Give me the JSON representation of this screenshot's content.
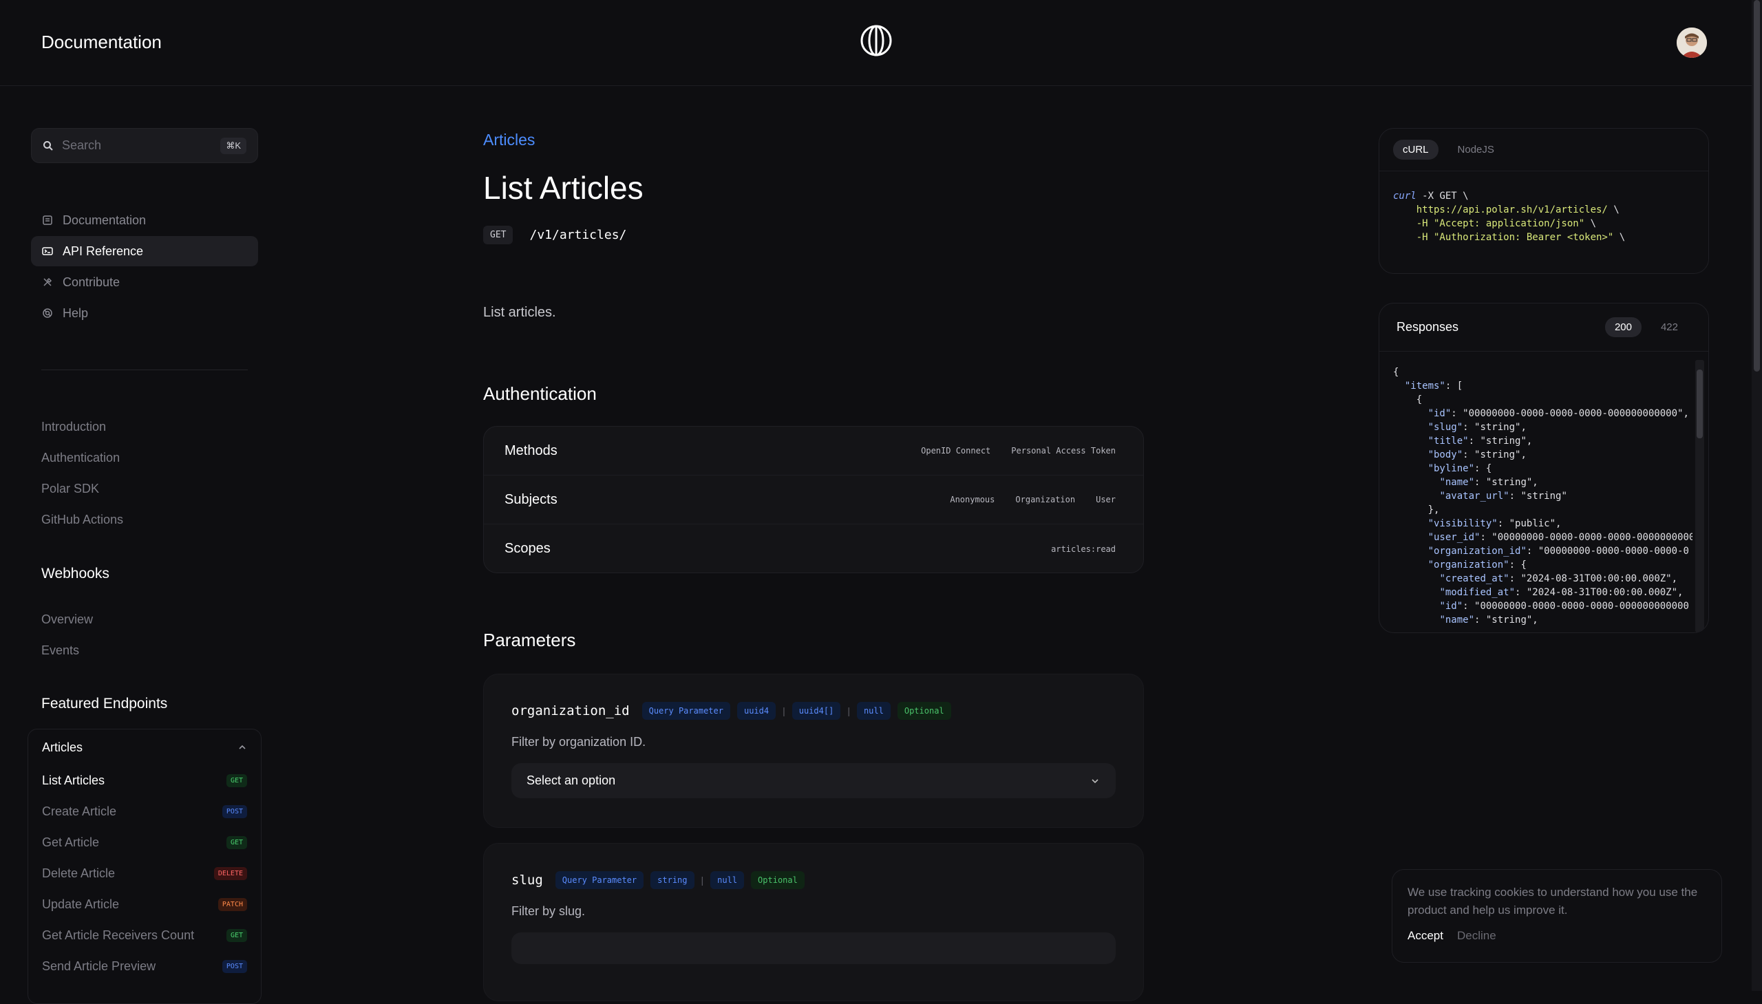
{
  "header": {
    "title": "Documentation"
  },
  "search": {
    "placeholder": "Search",
    "shortcut": "⌘K"
  },
  "sidebar": {
    "main_items": [
      {
        "label": "Documentation",
        "icon": "book-icon"
      },
      {
        "label": "API Reference",
        "icon": "terminal-icon",
        "active": true
      },
      {
        "label": "Contribute",
        "icon": "tools-icon"
      },
      {
        "label": "Help",
        "icon": "lifebuoy-icon"
      }
    ],
    "sub_items": [
      "Introduction",
      "Authentication",
      "Polar SDK",
      "GitHub Actions"
    ],
    "webhooks": {
      "title": "Webhooks",
      "items": [
        "Overview",
        "Events"
      ]
    },
    "featured": {
      "title": "Featured Endpoints",
      "group": "Articles",
      "endpoints": [
        {
          "label": "List Articles",
          "method": "GET",
          "active": true
        },
        {
          "label": "Create Article",
          "method": "POST"
        },
        {
          "label": "Get Article",
          "method": "GET"
        },
        {
          "label": "Delete Article",
          "method": "DELETE"
        },
        {
          "label": "Update Article",
          "method": "PATCH"
        },
        {
          "label": "Get Article Receivers Count",
          "method": "GET"
        },
        {
          "label": "Send Article Preview",
          "method": "POST"
        }
      ]
    }
  },
  "main": {
    "breadcrumb": "Articles",
    "title": "List Articles",
    "method": "GET",
    "endpoint": "/v1/articles/",
    "description": "List articles.",
    "auth": {
      "title": "Authentication",
      "rows": [
        {
          "label": "Methods",
          "values": [
            "OpenID Connect",
            "Personal Access Token"
          ]
        },
        {
          "label": "Subjects",
          "values": [
            "Anonymous",
            "Organization",
            "User"
          ]
        },
        {
          "label": "Scopes",
          "values": [
            "articles:read"
          ]
        }
      ]
    },
    "parameters": {
      "title": "Parameters",
      "items": [
        {
          "name": "organization_id",
          "location": "Query Parameter",
          "types": [
            "uuid4",
            "uuid4[]",
            "null"
          ],
          "optional": "Optional",
          "description": "Filter by organization ID.",
          "select_placeholder": "Select an option"
        },
        {
          "name": "slug",
          "location": "Query Parameter",
          "types": [
            "string",
            "null"
          ],
          "optional": "Optional",
          "description": "Filter by slug."
        }
      ]
    }
  },
  "code_panel": {
    "tabs": [
      "cURL",
      "NodeJS"
    ],
    "active_tab": "cURL",
    "lines": [
      "curl -X GET \\",
      "  https://api.polar.sh/v1/articles/ \\",
      "  -H \"Accept: application/json\" \\",
      "  -H \"Authorization: Bearer <token>\" \\"
    ]
  },
  "responses": {
    "title": "Responses",
    "codes": [
      "200",
      "422"
    ],
    "active_code": "200",
    "json_lines": [
      "{",
      "  \"items\": [",
      "    {",
      "      \"id\": \"00000000-0000-0000-0000-000000000000\",",
      "      \"slug\": \"string\",",
      "      \"title\": \"string\",",
      "      \"body\": \"string\",",
      "      \"byline\": {",
      "        \"name\": \"string\",",
      "        \"avatar_url\": \"string\"",
      "      },",
      "      \"visibility\": \"public\",",
      "      \"user_id\": \"00000000-0000-0000-0000-000000000000",
      "      \"organization_id\": \"00000000-0000-0000-0000-0",
      "      \"organization\": {",
      "        \"created_at\": \"2024-08-31T00:00:00.000Z\",",
      "        \"modified_at\": \"2024-08-31T00:00:00.000Z\",",
      "        \"id\": \"00000000-0000-0000-0000-000000000000",
      "        \"name\": \"string\","
    ]
  },
  "cookie": {
    "message": "We use tracking cookies to understand how you use the product and help us improve it.",
    "accept": "Accept",
    "decline": "Decline"
  },
  "colors": {
    "accent": "#4d8dff",
    "background": "#0e0e11"
  }
}
